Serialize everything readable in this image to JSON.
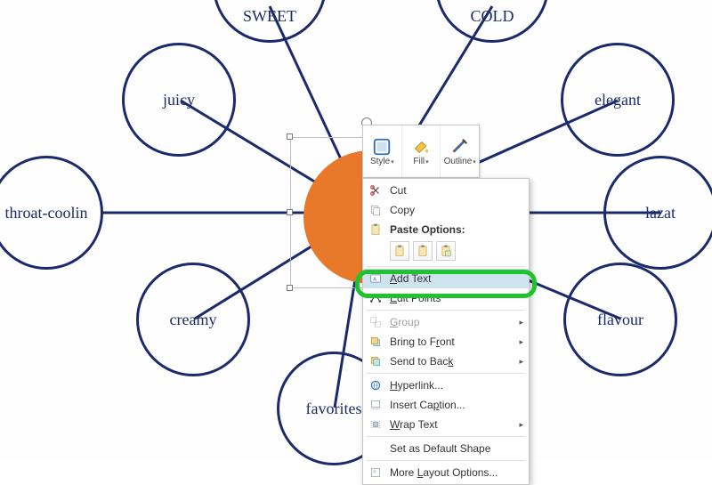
{
  "diagram": {
    "nodes": {
      "sweet": "SWEET",
      "cold": "COLD",
      "juicy": "juicy",
      "elegant": "elegant",
      "throat": "throat-coolin",
      "lazat": "lazat",
      "creamy": "creamy",
      "flavour": "flavour",
      "favorites": "favorites"
    }
  },
  "mini_toolbar": {
    "style": "Style",
    "fill": "Fill",
    "outline": "Outline"
  },
  "context_menu": {
    "cut": "Cut",
    "copy": "Copy",
    "paste_options": "Paste Options:",
    "add_text": "Add Text",
    "edit_points": "Edit Points",
    "group": "Group",
    "bring_front": "Bring to Front",
    "send_back": "Send to Back",
    "hyperlink": "Hyperlink...",
    "insert_caption": "Insert Caption...",
    "wrap_text": "Wrap Text",
    "set_default": "Set as Default Shape",
    "more_layout": "More Layout Options..."
  }
}
